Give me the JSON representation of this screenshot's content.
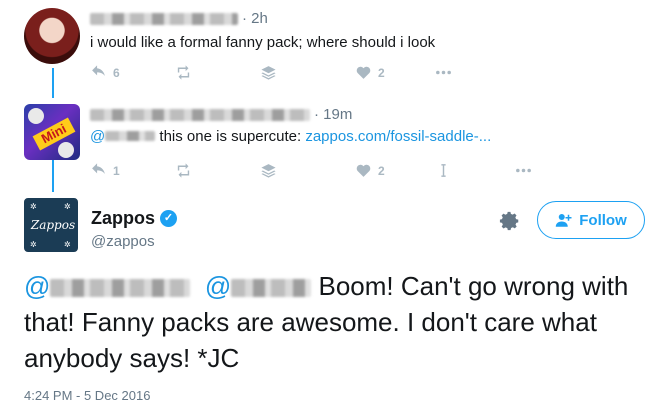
{
  "tweet1": {
    "time": "· 2h",
    "text": "i would like a formal fanny pack; where should i look",
    "reply_count": "6",
    "like_count": "2"
  },
  "tweet2": {
    "time": "· 19m",
    "mention_prefix": "@",
    "text": "this one is supercute: ",
    "link": "zappos.com/fossil-saddle-...",
    "avatar_label": "Mini",
    "reply_count": "1",
    "like_count": "2"
  },
  "main_tweet": {
    "name": "Zappos",
    "handle": "@zappos",
    "logo_text": "Zappos",
    "follow_label": "Follow",
    "mention_1": "@",
    "mention_2": "@",
    "body": " Boom! Can't go wrong with that! Fanny packs are awesome. I don't care what anybody says!  *JC",
    "timestamp": "4:24 PM - 5 Dec 2016"
  },
  "colors": {
    "accent": "#1da1f2",
    "link": "#1b95e0",
    "muted": "#657786",
    "icon": "#aab8c2"
  }
}
